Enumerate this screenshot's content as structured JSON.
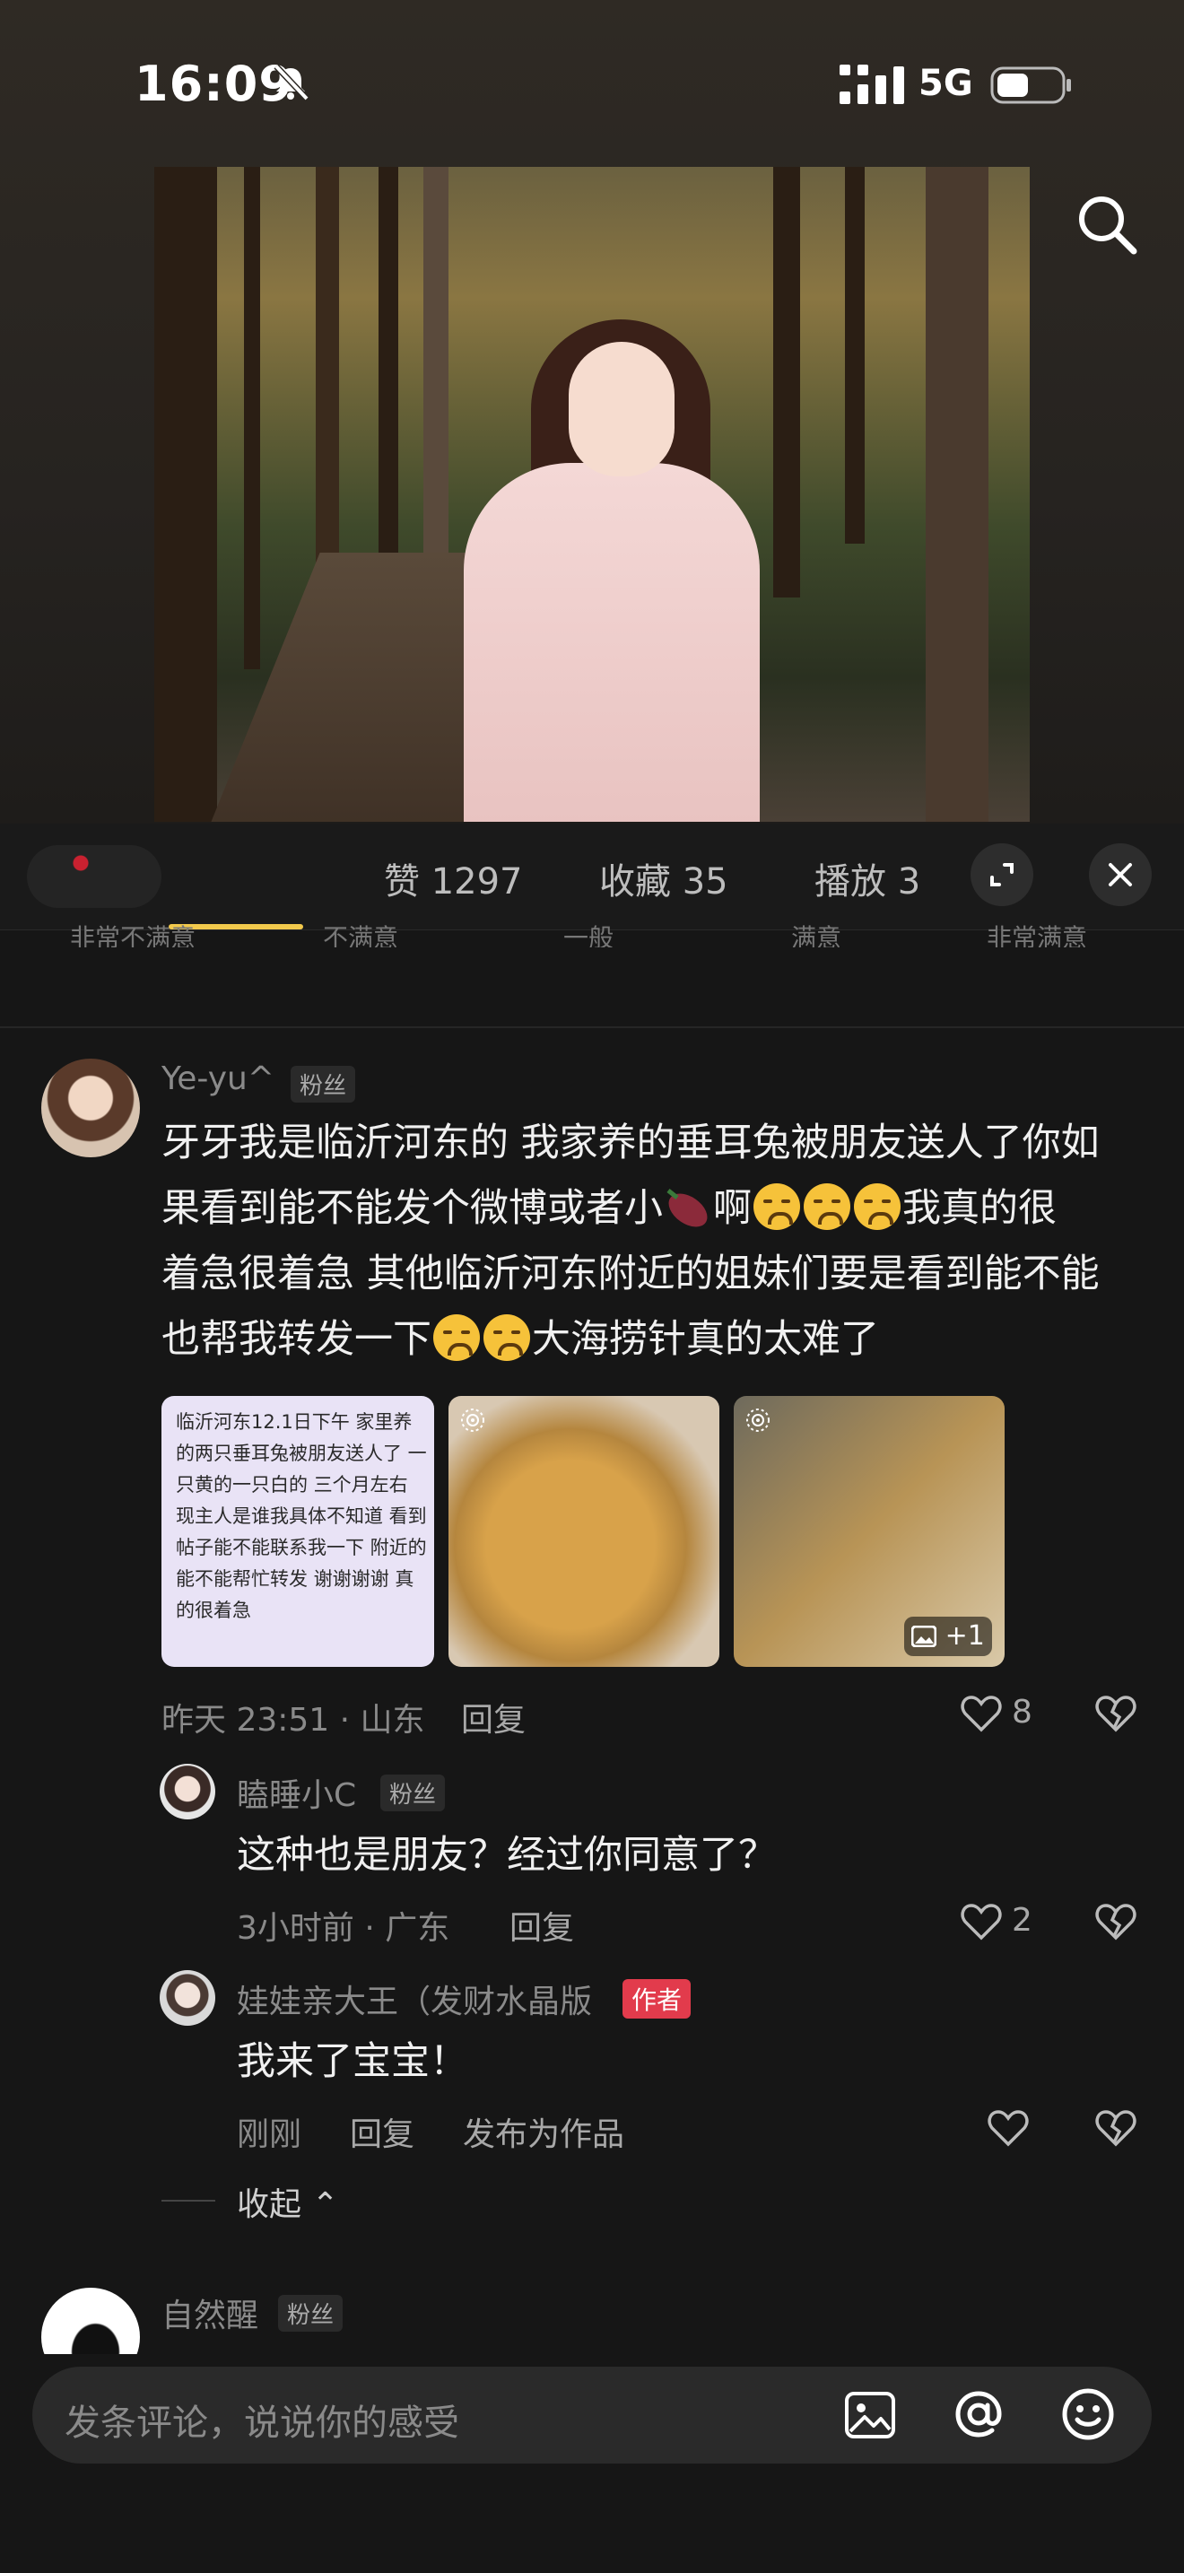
{
  "status_bar": {
    "time": "16:09",
    "network": "5G"
  },
  "stats": {
    "likes": "赞 1297",
    "favorites": "收藏 35",
    "plays": "播放 3"
  },
  "ratings": [
    "非常不满意",
    "不满意",
    "一般",
    "满意",
    "非常满意"
  ],
  "comments": {
    "c1": {
      "user": "Ye-yu^",
      "badge": "粉丝",
      "text_line1": "牙牙我是临沂河东的 我家养的垂耳兔被朋友送人了你如",
      "text_line2a": "果看到能不能发个微博或者小",
      "text_line2b": "啊",
      "text_line2c": "我真的很",
      "text_line3": "着急很着急 其他临沂河东附近的姐妹们要是看到能不能",
      "text_line4a": "也帮我转发一下",
      "text_line4b": "大海捞针真的太难了",
      "thumb1_text": "临沂河东12.1日下午 家里养的两只垂耳兔被朋友送人了 一只黄的一只白的 三个月左右 现主人是谁我具体不知道 看到帖子能不能联系我一下 附近的能不能帮忙转发 谢谢谢谢 真的很着急",
      "image_more": "+1",
      "meta": "昨天 23:51 · 山东",
      "reply": "回复",
      "likes": "8"
    },
    "c2": {
      "user": "瞌睡小C",
      "badge": "粉丝",
      "text": "这种也是朋友？经过你同意了？",
      "meta": "3小时前 · 广东",
      "reply": "回复",
      "likes": "2"
    },
    "c3": {
      "user": "娃娃亲大王（发财水晶版",
      "badge": "作者",
      "text": "我来了宝宝！",
      "meta": "刚刚",
      "reply": "回复",
      "publish": "发布为作品"
    },
    "collapse": "收起 ⌃",
    "c4": {
      "user": "自然醒",
      "badge": "粉丝"
    }
  },
  "input": {
    "placeholder": "发条评论，说说你的感受"
  },
  "icons": [
    "mute-icon",
    "signal-icon",
    "battery-icon",
    "search-icon",
    "expand-icon",
    "close-icon",
    "heart-icon",
    "broken-heart-icon",
    "image-icon",
    "at-icon",
    "emoji-icon",
    "live-photo-icon"
  ]
}
